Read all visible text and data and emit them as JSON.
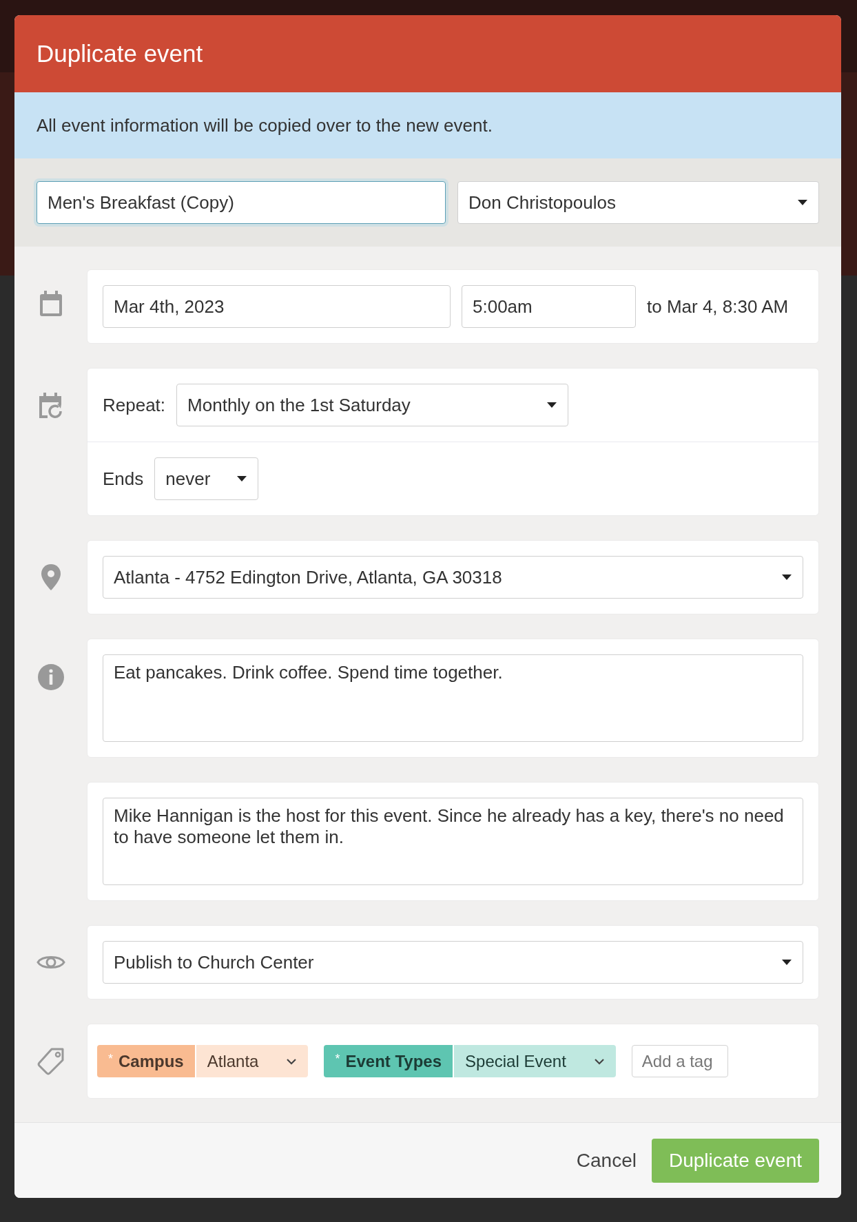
{
  "dialog": {
    "title": "Duplicate event",
    "notice": "All event information will be copied over to the new event.",
    "name_field": {
      "value": "Men's Breakfast (Copy)",
      "focused": true
    },
    "owner_select": {
      "value": "Don Christopoulos"
    },
    "schedule": {
      "date": "Mar 4th, 2023",
      "time": "5:00am",
      "end_text": "to Mar 4, 8:30 AM"
    },
    "repeat": {
      "label": "Repeat:",
      "value": "Monthly on the 1st Saturday",
      "ends_label": "Ends",
      "ends_value": "never"
    },
    "location": {
      "value": "Atlanta - 4752 Edington Drive, Atlanta, GA 30318"
    },
    "description": {
      "value": "Eat pancakes. Drink coffee. Spend time together."
    },
    "notes": {
      "value": "Mike Hannigan is the host for this event. Since he already has a key, there's no need to have someone let them in."
    },
    "visibility": {
      "value": "Publish to Church Center"
    },
    "tags": [
      {
        "marker": "*",
        "group": "Campus",
        "value": "Atlanta",
        "color": "#f9bb91"
      },
      {
        "marker": "*",
        "group": "Event Types",
        "value": "Special Event",
        "color": "#5ec5b1"
      }
    ],
    "add_tag": {
      "placeholder": "Add a tag"
    },
    "buttons": {
      "cancel": "Cancel",
      "confirm": "Duplicate event"
    }
  }
}
